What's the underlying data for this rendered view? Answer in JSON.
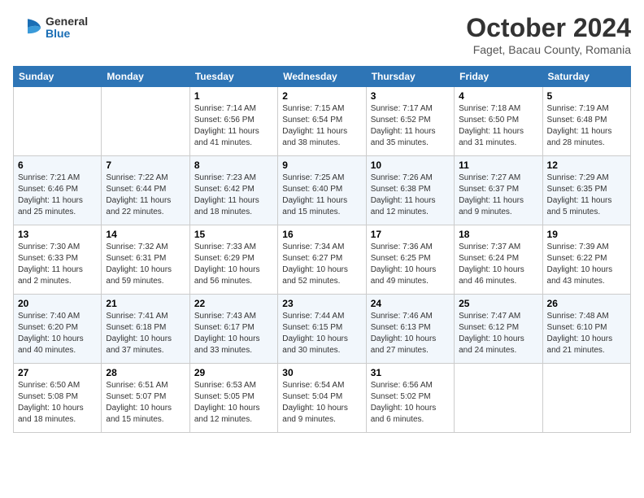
{
  "header": {
    "logo_general": "General",
    "logo_blue": "Blue",
    "month_title": "October 2024",
    "subtitle": "Faget, Bacau County, Romania"
  },
  "days_of_week": [
    "Sunday",
    "Monday",
    "Tuesday",
    "Wednesday",
    "Thursday",
    "Friday",
    "Saturday"
  ],
  "weeks": [
    [
      {
        "day": "",
        "info": ""
      },
      {
        "day": "",
        "info": ""
      },
      {
        "day": "1",
        "info": "Sunrise: 7:14 AM\nSunset: 6:56 PM\nDaylight: 11 hours and 41 minutes."
      },
      {
        "day": "2",
        "info": "Sunrise: 7:15 AM\nSunset: 6:54 PM\nDaylight: 11 hours and 38 minutes."
      },
      {
        "day": "3",
        "info": "Sunrise: 7:17 AM\nSunset: 6:52 PM\nDaylight: 11 hours and 35 minutes."
      },
      {
        "day": "4",
        "info": "Sunrise: 7:18 AM\nSunset: 6:50 PM\nDaylight: 11 hours and 31 minutes."
      },
      {
        "day": "5",
        "info": "Sunrise: 7:19 AM\nSunset: 6:48 PM\nDaylight: 11 hours and 28 minutes."
      }
    ],
    [
      {
        "day": "6",
        "info": "Sunrise: 7:21 AM\nSunset: 6:46 PM\nDaylight: 11 hours and 25 minutes."
      },
      {
        "day": "7",
        "info": "Sunrise: 7:22 AM\nSunset: 6:44 PM\nDaylight: 11 hours and 22 minutes."
      },
      {
        "day": "8",
        "info": "Sunrise: 7:23 AM\nSunset: 6:42 PM\nDaylight: 11 hours and 18 minutes."
      },
      {
        "day": "9",
        "info": "Sunrise: 7:25 AM\nSunset: 6:40 PM\nDaylight: 11 hours and 15 minutes."
      },
      {
        "day": "10",
        "info": "Sunrise: 7:26 AM\nSunset: 6:38 PM\nDaylight: 11 hours and 12 minutes."
      },
      {
        "day": "11",
        "info": "Sunrise: 7:27 AM\nSunset: 6:37 PM\nDaylight: 11 hours and 9 minutes."
      },
      {
        "day": "12",
        "info": "Sunrise: 7:29 AM\nSunset: 6:35 PM\nDaylight: 11 hours and 5 minutes."
      }
    ],
    [
      {
        "day": "13",
        "info": "Sunrise: 7:30 AM\nSunset: 6:33 PM\nDaylight: 11 hours and 2 minutes."
      },
      {
        "day": "14",
        "info": "Sunrise: 7:32 AM\nSunset: 6:31 PM\nDaylight: 10 hours and 59 minutes."
      },
      {
        "day": "15",
        "info": "Sunrise: 7:33 AM\nSunset: 6:29 PM\nDaylight: 10 hours and 56 minutes."
      },
      {
        "day": "16",
        "info": "Sunrise: 7:34 AM\nSunset: 6:27 PM\nDaylight: 10 hours and 52 minutes."
      },
      {
        "day": "17",
        "info": "Sunrise: 7:36 AM\nSunset: 6:25 PM\nDaylight: 10 hours and 49 minutes."
      },
      {
        "day": "18",
        "info": "Sunrise: 7:37 AM\nSunset: 6:24 PM\nDaylight: 10 hours and 46 minutes."
      },
      {
        "day": "19",
        "info": "Sunrise: 7:39 AM\nSunset: 6:22 PM\nDaylight: 10 hours and 43 minutes."
      }
    ],
    [
      {
        "day": "20",
        "info": "Sunrise: 7:40 AM\nSunset: 6:20 PM\nDaylight: 10 hours and 40 minutes."
      },
      {
        "day": "21",
        "info": "Sunrise: 7:41 AM\nSunset: 6:18 PM\nDaylight: 10 hours and 37 minutes."
      },
      {
        "day": "22",
        "info": "Sunrise: 7:43 AM\nSunset: 6:17 PM\nDaylight: 10 hours and 33 minutes."
      },
      {
        "day": "23",
        "info": "Sunrise: 7:44 AM\nSunset: 6:15 PM\nDaylight: 10 hours and 30 minutes."
      },
      {
        "day": "24",
        "info": "Sunrise: 7:46 AM\nSunset: 6:13 PM\nDaylight: 10 hours and 27 minutes."
      },
      {
        "day": "25",
        "info": "Sunrise: 7:47 AM\nSunset: 6:12 PM\nDaylight: 10 hours and 24 minutes."
      },
      {
        "day": "26",
        "info": "Sunrise: 7:48 AM\nSunset: 6:10 PM\nDaylight: 10 hours and 21 minutes."
      }
    ],
    [
      {
        "day": "27",
        "info": "Sunrise: 6:50 AM\nSunset: 5:08 PM\nDaylight: 10 hours and 18 minutes."
      },
      {
        "day": "28",
        "info": "Sunrise: 6:51 AM\nSunset: 5:07 PM\nDaylight: 10 hours and 15 minutes."
      },
      {
        "day": "29",
        "info": "Sunrise: 6:53 AM\nSunset: 5:05 PM\nDaylight: 10 hours and 12 minutes."
      },
      {
        "day": "30",
        "info": "Sunrise: 6:54 AM\nSunset: 5:04 PM\nDaylight: 10 hours and 9 minutes."
      },
      {
        "day": "31",
        "info": "Sunrise: 6:56 AM\nSunset: 5:02 PM\nDaylight: 10 hours and 6 minutes."
      },
      {
        "day": "",
        "info": ""
      },
      {
        "day": "",
        "info": ""
      }
    ]
  ]
}
